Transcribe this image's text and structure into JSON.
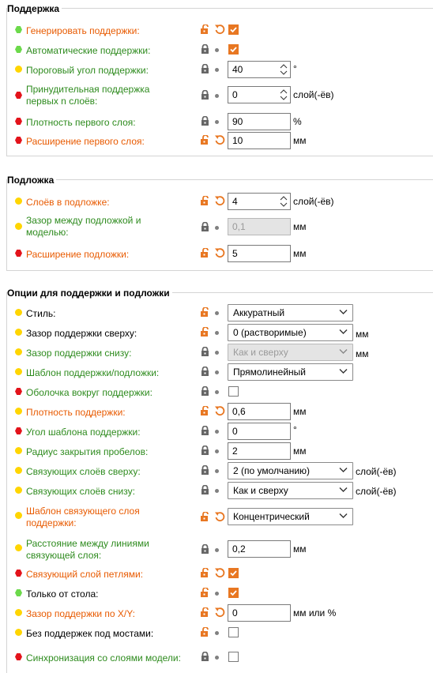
{
  "colors": {
    "green": "#2e8b1e",
    "orange": "#e85a00",
    "dot_green": "#6cd94b",
    "dot_yellow": "#ffd500",
    "dot_red": "#e3131b",
    "accent": "#e87722"
  },
  "sections": {
    "support": {
      "title": "Поддержка"
    },
    "raft": {
      "title": "Подложка"
    },
    "options": {
      "title": "Опции для поддержки и подложки"
    }
  },
  "rows": {
    "gen_support": {
      "label": "Генерировать поддержки:",
      "checked": true
    },
    "auto_support": {
      "label": "Автоматические поддержки:",
      "checked": true
    },
    "threshold": {
      "label": "Пороговый угол поддержки:",
      "value": "40",
      "unit": "°"
    },
    "enforce_line1": "Принудительная поддержка",
    "enforce_line2": "первых n слоёв:",
    "enforce": {
      "value": "0",
      "unit": "слой(-ёв)"
    },
    "first_density": {
      "label": "Плотность первого слоя:",
      "value": "90",
      "unit": "%"
    },
    "first_expansion": {
      "label": "Расширение первого слоя:",
      "value": "10",
      "unit": "мм"
    },
    "raft_layers": {
      "label": "Слоёв в подложке:",
      "value": "4",
      "unit": "слой(-ёв)"
    },
    "raft_gap_line1": "Зазор между подложкой и",
    "raft_gap_line2": "моделью:",
    "raft_gap": {
      "value": "0,1",
      "unit": "мм"
    },
    "raft_expansion": {
      "label": "Расширение подложки:",
      "value": "5",
      "unit": "мм"
    },
    "style": {
      "label": "Стиль:",
      "value": "Аккуратный"
    },
    "top_gap": {
      "label": "Зазор поддержки сверху:",
      "value": "0 (растворимые)",
      "unit": "мм"
    },
    "bottom_gap": {
      "label": "Зазор поддержки снизу:",
      "value": "Как и сверху",
      "unit": "мм"
    },
    "pattern": {
      "label": "Шаблон поддержки/подложки:",
      "value": "Прямолинейный"
    },
    "with_sheath": {
      "label": "Оболочка вокруг поддержки:",
      "checked": false
    },
    "density": {
      "label": "Плотность поддержки:",
      "value": "0,6",
      "unit": "мм"
    },
    "pattern_angle": {
      "label": "Угол шаблона поддержки:",
      "value": "0",
      "unit": "°"
    },
    "closing_radius": {
      "label": "Радиус закрытия пробелов:",
      "value": "2",
      "unit": "мм"
    },
    "top_interface": {
      "label": "Связующих слоёв сверху:",
      "value": "2 (по умолчанию)",
      "unit": "слой(-ёв)"
    },
    "bottom_interface": {
      "label": "Связующих слоёв снизу:",
      "value": "Как и сверху",
      "unit": "слой(-ёв)"
    },
    "interface_pattern_line1": "Шаблон связующего слоя",
    "interface_pattern_line2": "поддержки:",
    "interface_pattern": {
      "value": "Концентрический"
    },
    "interface_spacing_line1": "Расстояние между линиями",
    "interface_spacing_line2": "связующей слоя:",
    "interface_spacing": {
      "value": "0,2",
      "unit": "мм"
    },
    "interface_loops": {
      "label": "Связующий слой петлями:",
      "checked": true
    },
    "buildplate_only": {
      "label": "Только от стола:",
      "checked": true
    },
    "xy_gap": {
      "label": "Зазор поддержки по X/Y:",
      "value": "0",
      "unit": "мм или %"
    },
    "dont_bridge": {
      "label": "Без поддержек под мостами:",
      "checked": false
    },
    "sync_layers": {
      "label": "Синхронизация со слоями модели:",
      "checked": false
    }
  }
}
